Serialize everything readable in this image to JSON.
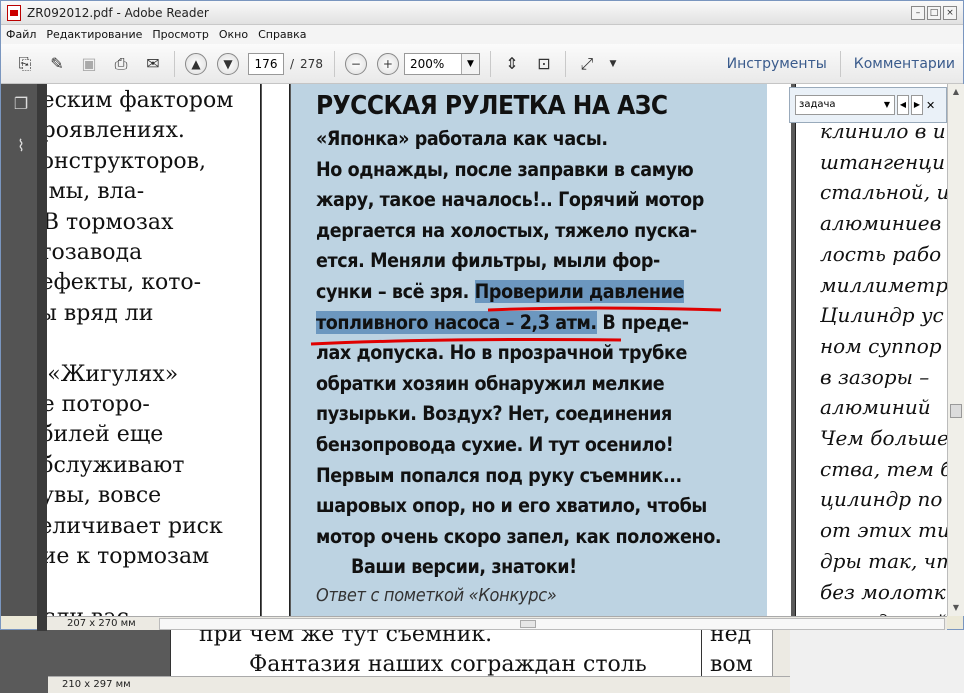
{
  "window": {
    "title": "ZR092012.pdf - Adobe Reader"
  },
  "menu": [
    "Файл",
    "Редактирование",
    "Просмотр",
    "Окно",
    "Справка"
  ],
  "toolbar": {
    "page_current": "176",
    "page_sep": "/",
    "page_total": "278",
    "zoom": "200%",
    "tools_label": "Инструменты",
    "comments_label": "Комментарии"
  },
  "search": {
    "value": "задача"
  },
  "left_page_lines": [
    "ческим фактором",
    "проявлениях.",
    "конструкторов,",
    "и мы, вла-",
    "! В тормозах",
    "втозавода",
    "дефекты, кото-",
    "вы вряд ли",
    "",
    "о «Жигулях»",
    "не поторо-",
    "обилей еще",
    "обслуживают",
    ", увы, вовсе",
    "величивает риск",
    "ние к тормозам",
    "о!",
    "Если вас"
  ],
  "article": {
    "title": "РУССКАЯ РУЛЕТКА НА АЗС",
    "lines": [
      "«Японка» работала как часы.",
      "Но однажды, после заправки в самую",
      "жару, такое началось!.. Горячий мотор",
      "дергается на холостых, тяжело пуска-",
      "ется. Меняли фильтры, мыли фор-"
    ],
    "line6_a": "сунки – всё зря. ",
    "line6_hl": "Проверили давление",
    "line7_hl": "топливного насоса – 2,3 атм.",
    "line7_b": " В преде-",
    "lines2": [
      "лах допуска. Но в прозрачной трубке",
      "обратки хозяин обнаружил мелкие",
      "пузырьки. Воздух? Нет, соединения",
      "бензопровода сухие. И тут осенило!",
      "Первым попался под руку съемник...",
      "шаровых опор, но и его хватило, чтобы",
      "мотор очень скоро запел, как положено.",
      "      Ваши версии, знатоки!"
    ],
    "answer": "Ответ с пометкой «Конкурс»"
  },
  "right_page_lines": [
    "клинило в и",
    "штангенци",
    "стальной, и",
    "алюминиев",
    "лость рабо",
    "миллиметр",
    "Цилиндр ус",
    "ном суппор",
    "в зазоры –",
    "алюминий",
    "Чем больше",
    "ства, тем б",
    "цилиндр по",
    "от этих ти",
    "дры так, чт",
    "без молотк",
    "то к другой"
  ],
  "status": {
    "page_size": "207 x 270 мм"
  },
  "back_window": {
    "line1": "при чем же тут съемник.",
    "line2": "Фантазия наших сограждан столь",
    "right1": "нед",
    "right2": "вом",
    "page_size": "210 x 297 мм"
  },
  "colors": {
    "highlight": "#6c97bf",
    "box_bg": "#bdd3e2",
    "underline": "#e00000"
  }
}
